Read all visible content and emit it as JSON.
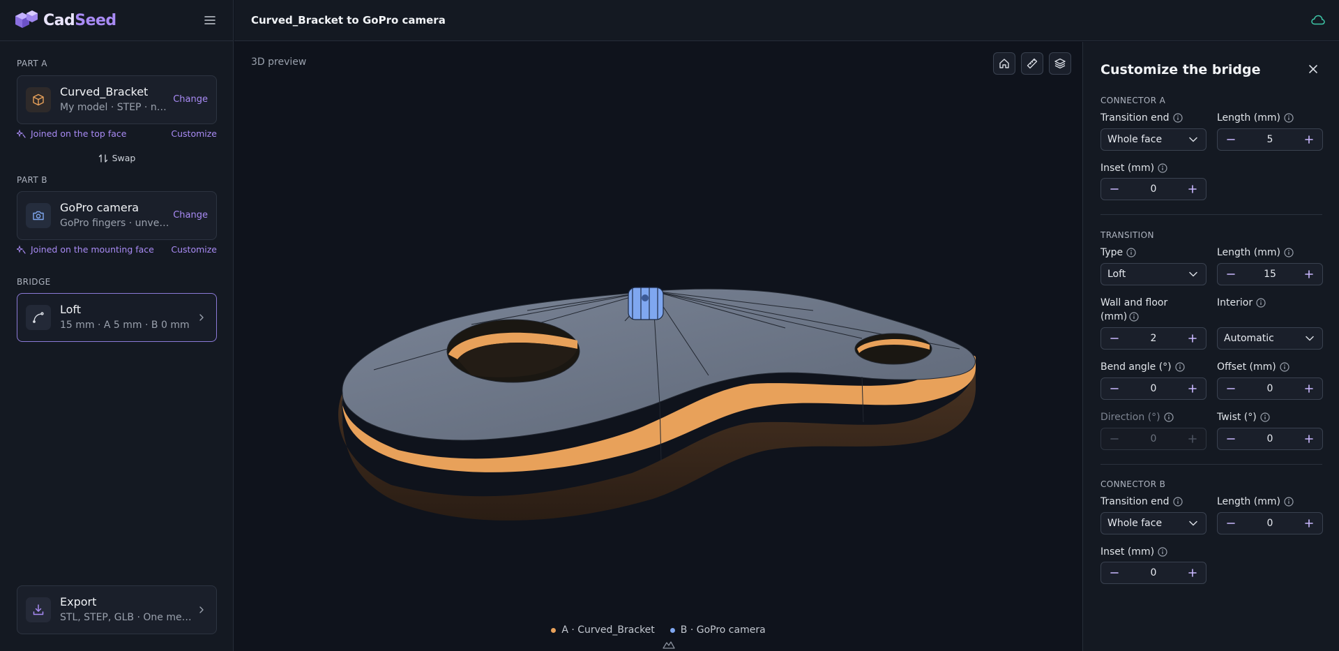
{
  "app": {
    "logo_a": "Cad",
    "logo_b": "Seed"
  },
  "header": {
    "title": "Curved_Bracket to GoPro camera"
  },
  "sidebar": {
    "part_a": {
      "label": "PART A",
      "title": "Curved_Bracket",
      "subtitle": "My model · STEP · not ...",
      "change": "Change",
      "joined": "Joined on the top face",
      "customize": "Customize"
    },
    "swap": "Swap",
    "part_b": {
      "label": "PART B",
      "title": "GoPro camera",
      "subtitle": "GoPro fingers · unveri...",
      "change": "Change",
      "joined": "Joined on the mounting face",
      "customize": "Customize"
    },
    "bridge": {
      "label": "BRIDGE",
      "title": "Loft",
      "subtitle": "15 mm · A 5 mm · B 0 mm"
    },
    "export": {
      "title": "Export",
      "subtitle": "STL, STEP, GLB · One merg..."
    }
  },
  "viewport": {
    "label": "3D preview",
    "legend": [
      {
        "text": "A · Curved_Bracket",
        "color": "#e8a15a"
      },
      {
        "text": "B · GoPro camera",
        "color": "#7fa7f0"
      }
    ],
    "part_a_color": "#e8a15a",
    "part_b_color": "#7fa7f0"
  },
  "panel": {
    "title": "Customize the bridge",
    "connector_a": {
      "label": "CONNECTOR A",
      "transition_end": {
        "label": "Transition end",
        "value": "Whole face"
      },
      "length": {
        "label": "Length (mm)",
        "value": "5"
      },
      "inset": {
        "label": "Inset (mm)",
        "value": "0"
      }
    },
    "transition": {
      "label": "TRANSITION",
      "type": {
        "label": "Type",
        "value": "Loft"
      },
      "length": {
        "label": "Length (mm)",
        "value": "15"
      },
      "wall": {
        "label": "Wall and floor (mm)",
        "value": "2"
      },
      "interior": {
        "label": "Interior",
        "value": "Automatic"
      },
      "bend": {
        "label": "Bend angle (°)",
        "value": "0"
      },
      "offset": {
        "label": "Offset (mm)",
        "value": "0"
      },
      "direction": {
        "label": "Direction (°)",
        "value": "0"
      },
      "twist": {
        "label": "Twist (°)",
        "value": "0"
      }
    },
    "connector_b": {
      "label": "CONNECTOR B",
      "transition_end": {
        "label": "Transition end",
        "value": "Whole face"
      },
      "length": {
        "label": "Length (mm)",
        "value": "0"
      },
      "inset": {
        "label": "Inset (mm)",
        "value": "0"
      }
    }
  },
  "accent_color": "#a98bf5"
}
